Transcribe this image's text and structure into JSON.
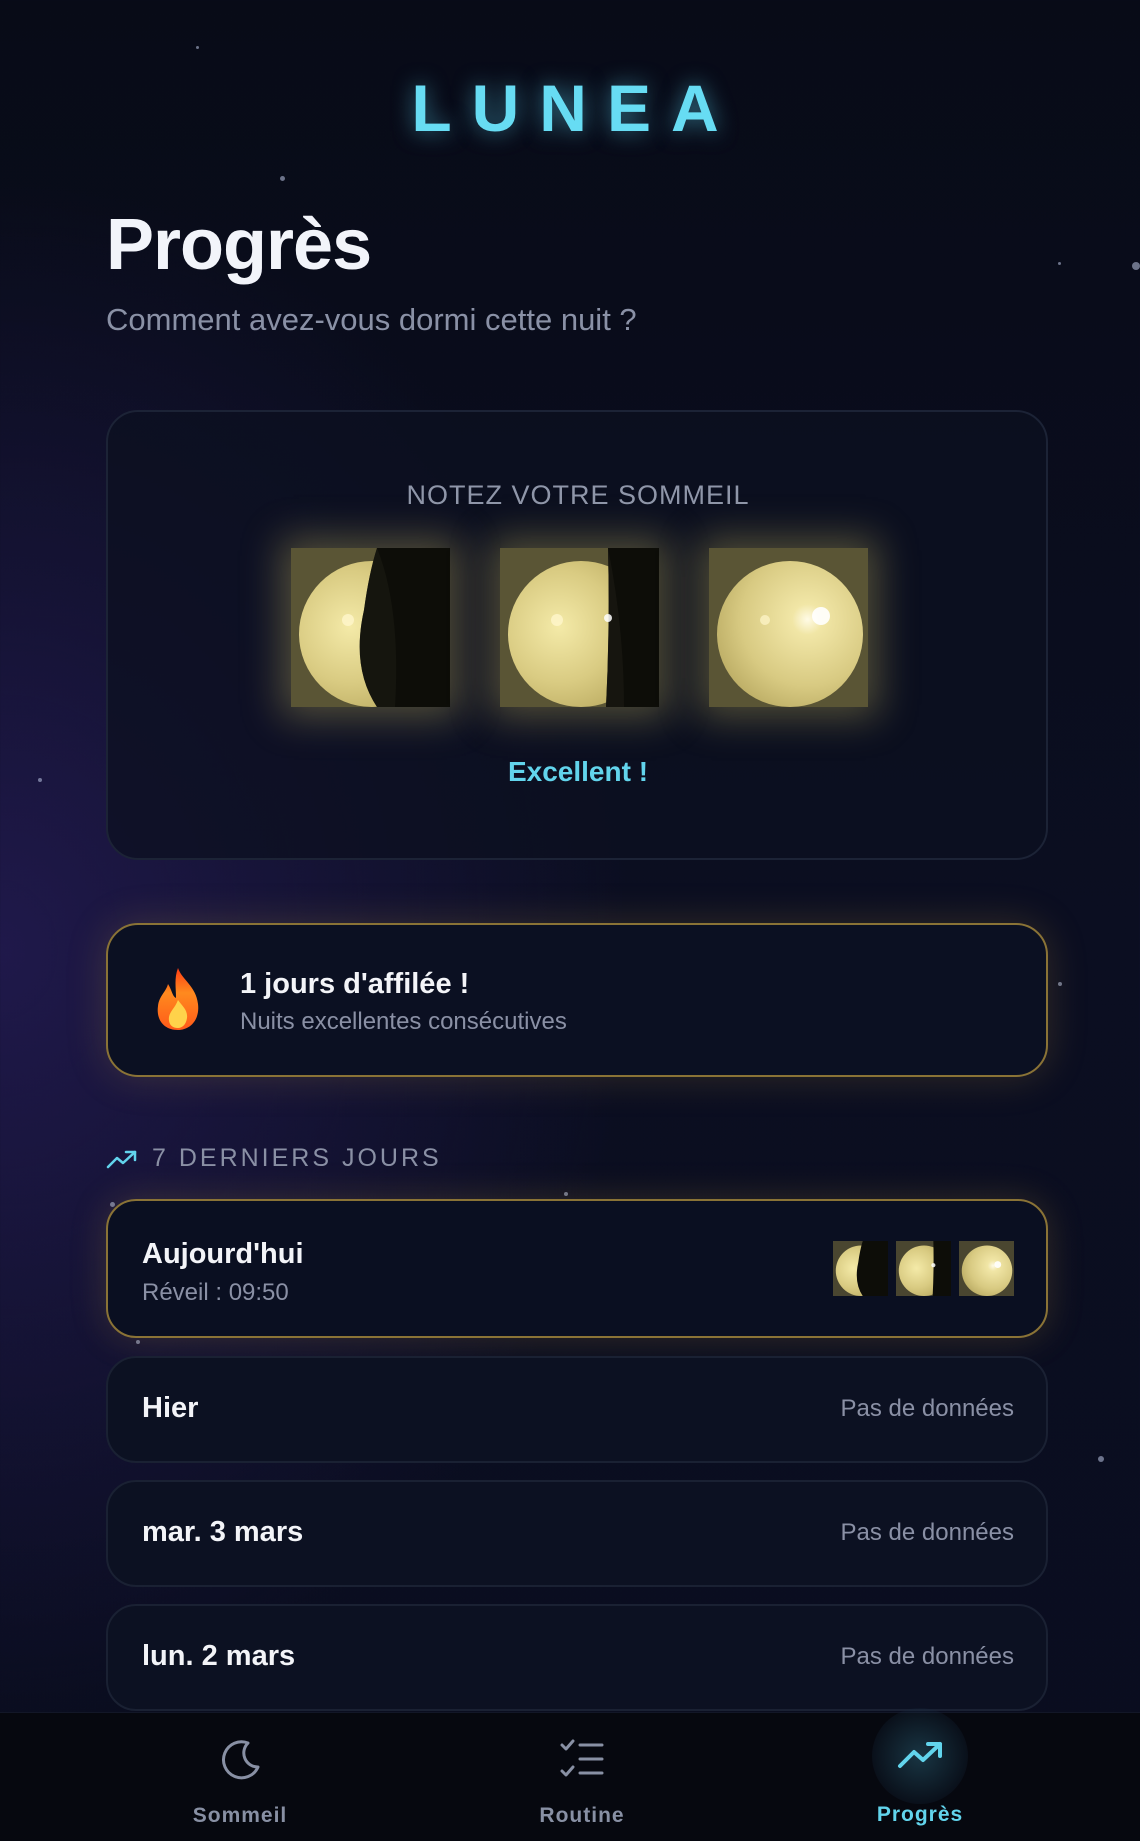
{
  "app": {
    "logo": "LUNEA"
  },
  "header": {
    "title": "Progrès",
    "subtitle": "Comment avez-vous dormi cette nuit ?"
  },
  "rating": {
    "label": "NOTEZ VOTRE SOMMEIL",
    "result": "Excellent !",
    "options": [
      "waning-moon-icon",
      "half-moon-icon",
      "full-moon-icon"
    ],
    "selected": 3,
    "max": 3
  },
  "streak": {
    "icon": "flame-icon",
    "title": "1 jours d'affilée !",
    "subtitle": "Nuits excellentes consécutives"
  },
  "history": {
    "title": "7 DERNIERS JOURS",
    "days": [
      {
        "name": "Aujourd'hui",
        "wake": "Réveil : 09:50",
        "rating": 3
      },
      {
        "name": "Hier",
        "status": "Pas de données"
      },
      {
        "name": "mar. 3 mars",
        "status": "Pas de données"
      },
      {
        "name": "lun. 2 mars",
        "status": "Pas de données"
      }
    ]
  },
  "nav": {
    "items": [
      {
        "label": "Sommeil",
        "icon": "moon-icon"
      },
      {
        "label": "Routine",
        "icon": "checklist-icon"
      },
      {
        "label": "Progrès",
        "icon": "trending-up-icon",
        "active": true
      }
    ]
  },
  "colors": {
    "accent": "#67dcf3",
    "gold": "#d8c87a",
    "background": "#0a0d1f"
  }
}
